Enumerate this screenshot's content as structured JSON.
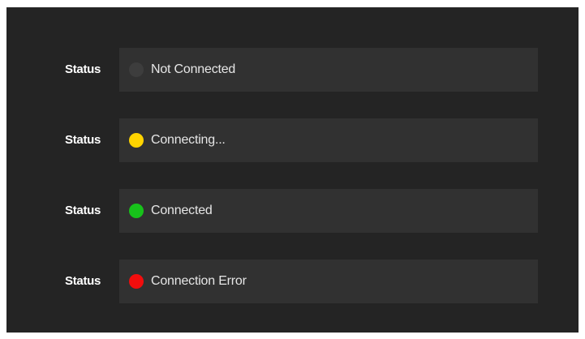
{
  "rows": [
    {
      "label": "Status",
      "text": "Not Connected",
      "state": "not-connected",
      "indicator_color": "#3d3d3d"
    },
    {
      "label": "Status",
      "text": "Connecting...",
      "state": "connecting",
      "indicator_color": "#ffd400"
    },
    {
      "label": "Status",
      "text": "Connected",
      "state": "connected",
      "indicator_color": "#17c21a"
    },
    {
      "label": "Status",
      "text": "Connection Error",
      "state": "error",
      "indicator_color": "#f20d0d"
    }
  ]
}
